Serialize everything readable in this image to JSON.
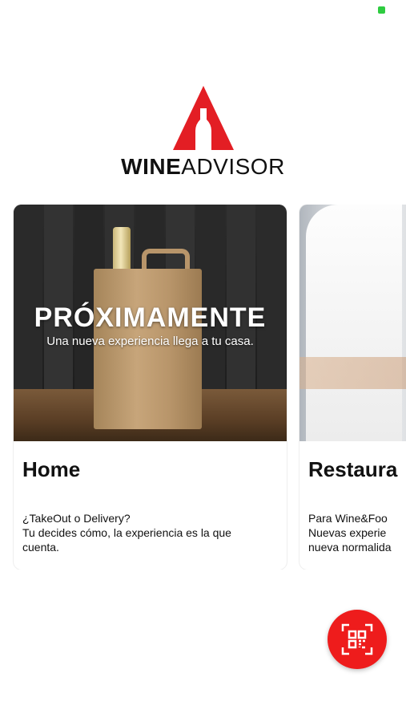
{
  "status_bar": {
    "indicator_color": "#2ecc40"
  },
  "logo": {
    "brand_bold": "WINE",
    "brand_light": "ADVISOR",
    "accent_color": "#e31e24"
  },
  "cards": [
    {
      "title": "Home",
      "promo_title": "PRÓXIMAMENTE",
      "promo_subtitle": "Una nueva experiencia llega a tu casa.",
      "description": "¿TakeOut o Delivery?\nTu decides cómo, la experiencia es la que cuenta."
    },
    {
      "title": "Restaura",
      "description": "Para Wine&Foo\nNuevas experie\nnueva normalida"
    }
  ],
  "fab": {
    "icon": "qr-scan-icon",
    "color": "#ee1c1c"
  }
}
